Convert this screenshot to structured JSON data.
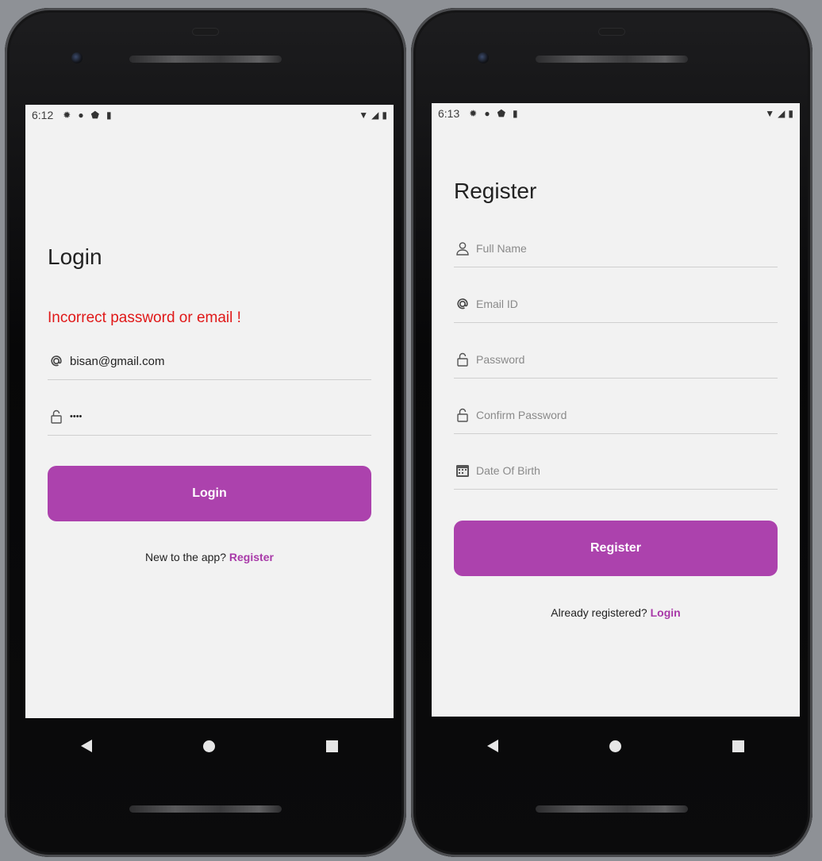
{
  "colors": {
    "accent": "#ac42ad",
    "link": "#a839a8",
    "error": "#e01818",
    "screen_bg": "#f2f2f2"
  },
  "login_screen": {
    "status_time": "6:12",
    "title": "Login",
    "error_message": "Incorrect password or email !",
    "email_field": {
      "value": "bisan@gmail.com",
      "icon": "at-icon"
    },
    "password_field": {
      "value": "••••",
      "icon": "lock-icon"
    },
    "login_button": "Login",
    "footer_prompt": "New to the app?",
    "footer_link": "Register"
  },
  "register_screen": {
    "status_time": "6:13",
    "title": "Register",
    "fields": [
      {
        "placeholder": "Full Name",
        "icon": "person-icon"
      },
      {
        "placeholder": "Email ID",
        "icon": "at-icon"
      },
      {
        "placeholder": "Password",
        "icon": "lock-icon"
      },
      {
        "placeholder": "Confirm Password",
        "icon": "lock-icon"
      },
      {
        "placeholder": "Date Of Birth",
        "icon": "calendar-icon"
      }
    ],
    "register_button": "Register",
    "footer_prompt": "Already registered?",
    "footer_link": "Login"
  }
}
